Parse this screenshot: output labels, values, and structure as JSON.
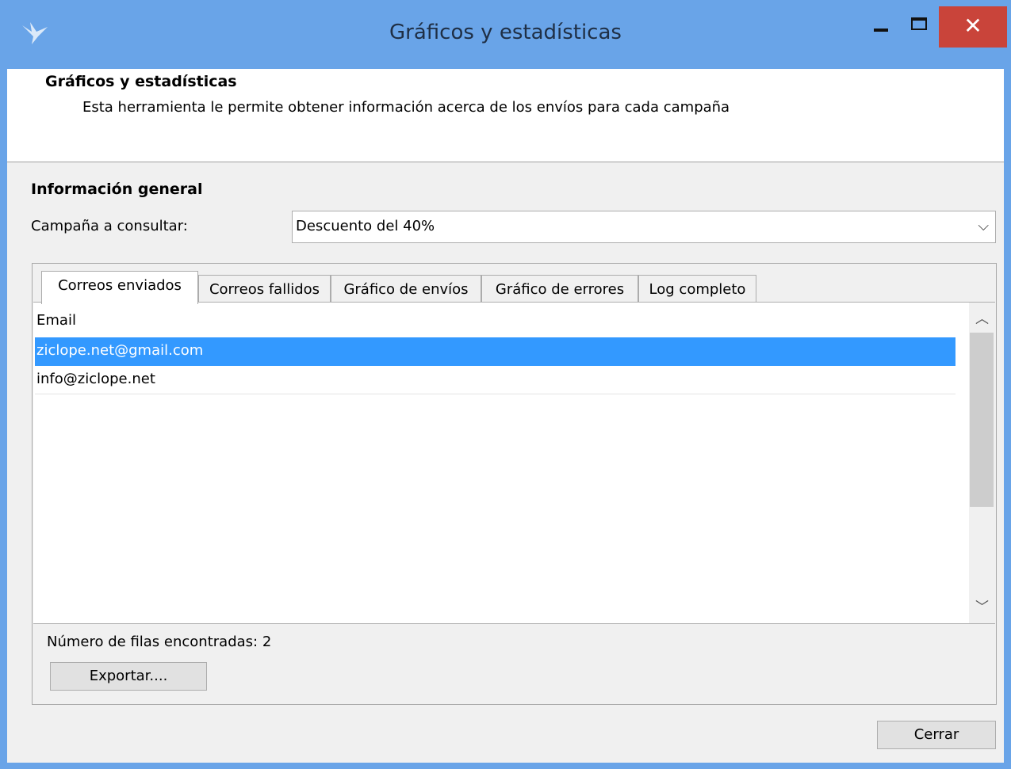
{
  "window": {
    "title": "Gráficos y estadísticas",
    "close_glyph": "✕",
    "accent_color": "#69a4e8",
    "close_button_color": "#c9443a",
    "app_icon": "bird-icon"
  },
  "header": {
    "title": "Gráficos y estadísticas",
    "description": "Esta herramienta le permite obtener información acerca de los envíos para cada campaña"
  },
  "general": {
    "section_title": "Información general",
    "campaign_label": "Campaña a consultar:",
    "campaign_value": "Descuento del 40%"
  },
  "tabs": [
    {
      "label": "Correos enviados",
      "active": true
    },
    {
      "label": "Correos fallidos",
      "active": false
    },
    {
      "label": "Gráfico de envíos",
      "active": false
    },
    {
      "label": "Gráfico de errores",
      "active": false
    },
    {
      "label": "Log completo",
      "active": false
    }
  ],
  "table": {
    "column_header": "Email",
    "rows": [
      {
        "email": "ziclope.net@gmail.com",
        "selected": true
      },
      {
        "email": "info@ziclope.net",
        "selected": false
      }
    ],
    "selection_color": "#3399ff"
  },
  "footer": {
    "row_count_label": "Número de filas encontradas:",
    "row_count": "2",
    "export_label": "Exportar....",
    "close_label": "Cerrar"
  }
}
